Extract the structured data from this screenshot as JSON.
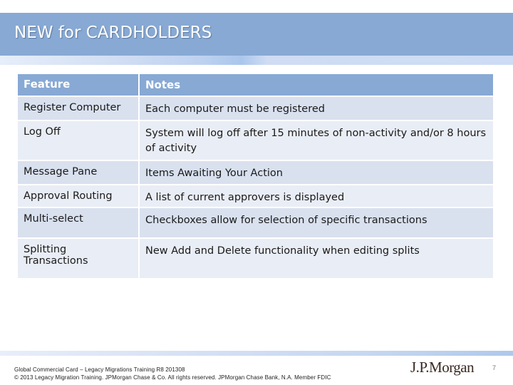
{
  "slide": {
    "title": "NEW for CARDHOLDERS",
    "colors": {
      "accent": "#87a9d4",
      "row_dark": "#d9e1ef",
      "row_light": "#e9edf5",
      "header_text": "#ffffff"
    }
  },
  "table": {
    "headers": [
      "Feature",
      "Notes"
    ],
    "rows": [
      {
        "feature": "Register Computer",
        "notes": "Each computer must be registered"
      },
      {
        "feature": "Log Off",
        "notes": "System will log off after 15 minutes of non-activity and/or 8 hours of activity"
      },
      {
        "feature": "Message Pane",
        "notes": "Items Awaiting Your Action"
      },
      {
        "feature": "Approval Routing",
        "notes": "A list of current approvers is displayed"
      },
      {
        "feature": "Multi-select",
        "notes": "Checkboxes allow for selection of specific transactions"
      },
      {
        "feature": "Splitting Transactions",
        "notes": "New Add and Delete functionality when editing splits"
      }
    ]
  },
  "footer": {
    "line1": "Global Commercial Card – Legacy Migrations Training R8 201308",
    "line2": "© 2013  Legacy Migration Training. JPMorgan Chase & Co. All rights reserved. JPMorgan Chase Bank, N.A. Member FDIC",
    "brand": "J.P.Morgan",
    "page_number": "7"
  }
}
